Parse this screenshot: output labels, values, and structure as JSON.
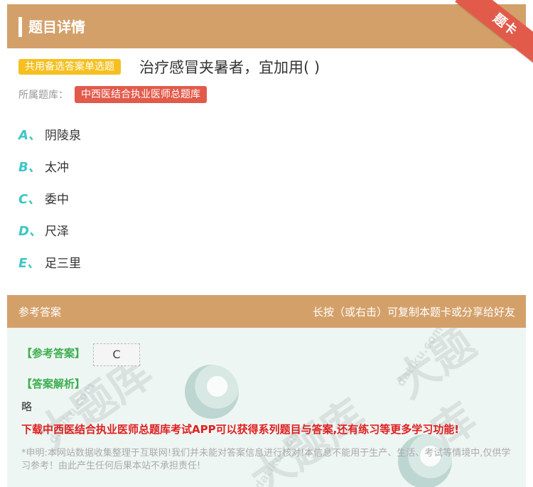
{
  "header": {
    "title": "题目详情",
    "corner_ribbon": "题卡"
  },
  "question": {
    "type_badge": "共用备选答案单选题",
    "text": "治疗感冒夹暑者，宜加用( )",
    "library_label": "所属题库：",
    "library_name": "中西医结合执业医师总题库"
  },
  "options": [
    {
      "letter": "A、",
      "text": "阴陵泉"
    },
    {
      "letter": "B、",
      "text": "太冲"
    },
    {
      "letter": "C、",
      "text": "委中"
    },
    {
      "letter": "D、",
      "text": "尺泽"
    },
    {
      "letter": "E、",
      "text": "足三里"
    }
  ],
  "answer_section": {
    "header_left": "参考答案",
    "header_right": "长按（或右击）可复制本题卡或分享给好友",
    "answer_tag": "【参考答案】",
    "answer_value": "C",
    "explanation_tag": "【答案解析】",
    "explanation_text": "略",
    "promo": "下载中西医结合执业医师总题库考试APP可以获得系列题目与答案,还有练习等更多学习功能!",
    "disclaimer": "*申明:本网站数据收集整理于互联网!我们并未能对答案信息进行核对!本信息不能用于生产、生活、考试等情境中,仅供学习参考！由此产生任何后果本站不承担责任!"
  },
  "colors": {
    "header_bg": "#d4a06a",
    "accent_red": "#e25a4a",
    "accent_yellow": "#f5c020",
    "option_letter": "#3cc6c6",
    "answer_green": "#3cae4f"
  }
}
